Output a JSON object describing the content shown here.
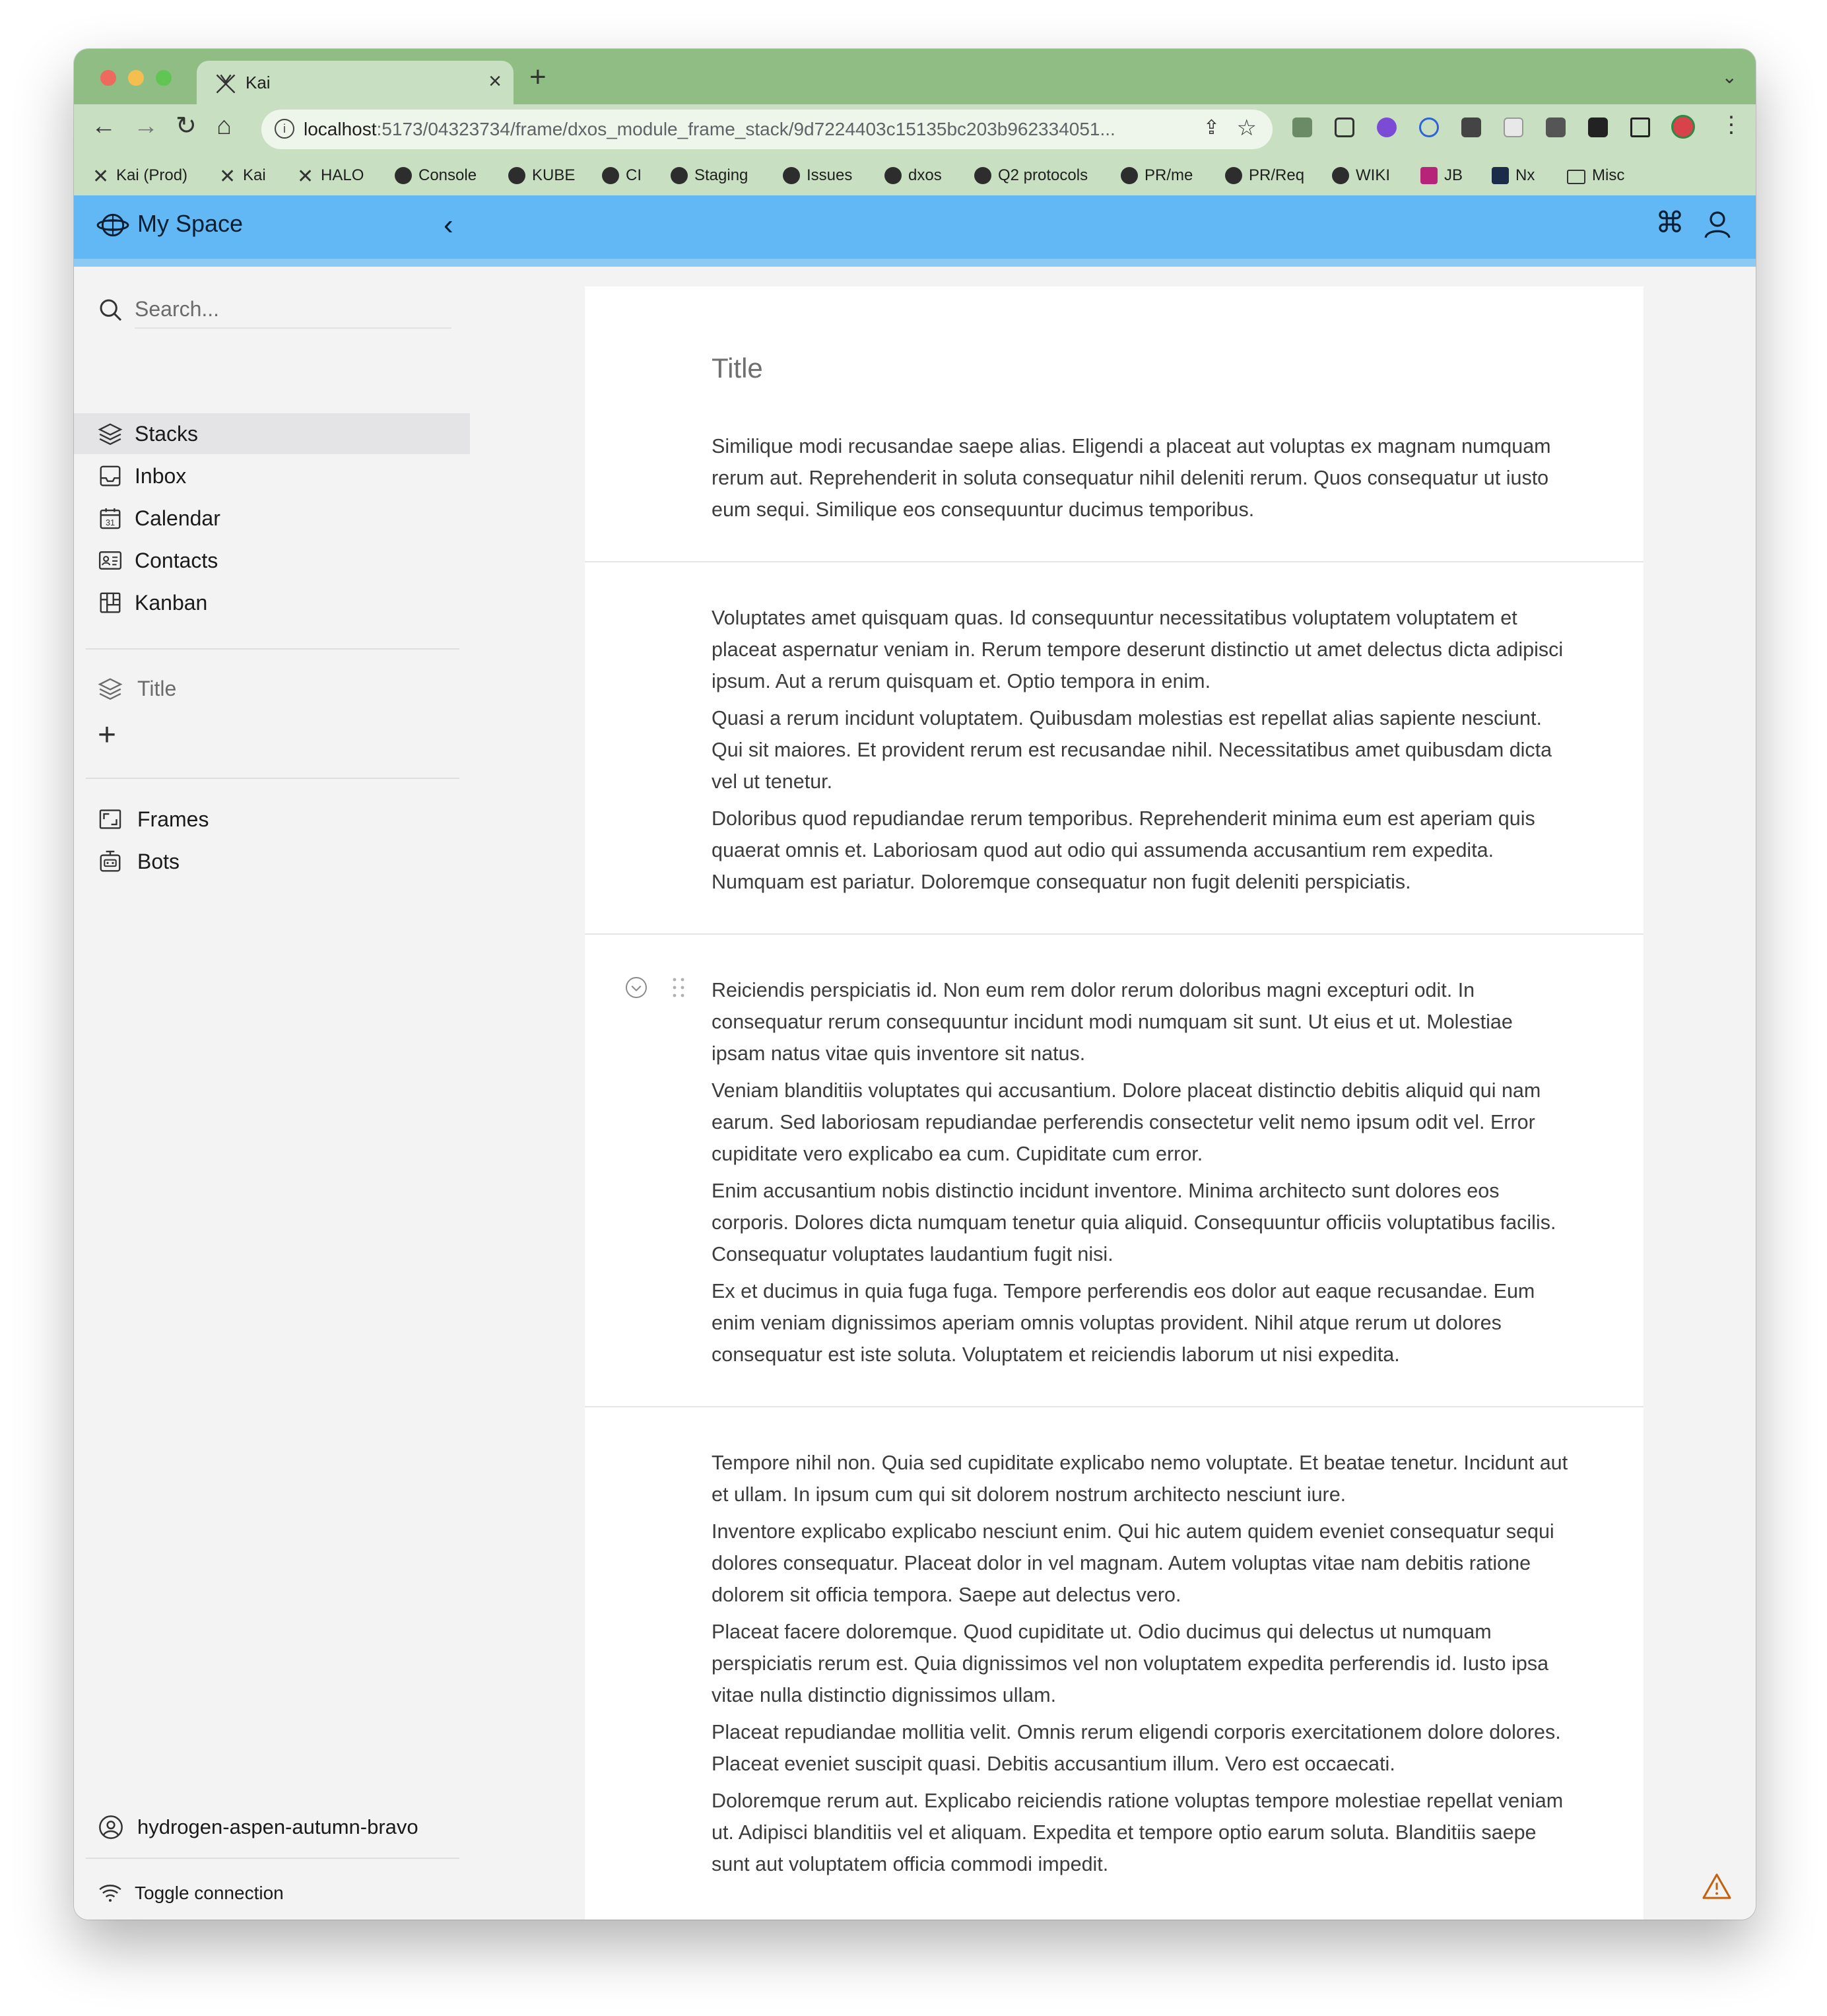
{
  "browser": {
    "tab_title": "Kai",
    "url_host": "localhost",
    "url_rest": ":5173/04323734/frame/dxos_module_frame_stack/9d7224403c15135bc203b962334051...",
    "bookmarks": [
      "Kai (Prod)",
      "Kai",
      "HALO",
      "Console",
      "KUBE",
      "CI",
      "Staging",
      "Issues",
      "dxos",
      "Q2 protocols",
      "PR/me",
      "PR/Req",
      "WIKI",
      "JB",
      "Nx",
      "Misc"
    ]
  },
  "header": {
    "space_name": "My Space"
  },
  "sidebar": {
    "search_placeholder": "Search...",
    "nav": [
      "Stacks",
      "Inbox",
      "Calendar",
      "Contacts",
      "Kanban"
    ],
    "stack_item": "Title",
    "frames": [
      "Frames",
      "Bots"
    ],
    "identity": "hydrogen-aspen-autumn-bravo",
    "toggle": "Toggle connection"
  },
  "stack": {
    "title": "Title",
    "sections": [
      [
        "Similique modi recusandae saepe alias. Eligendi a placeat aut voluptas ex magnam numquam rerum aut. Reprehenderit in soluta consequatur nihil deleniti rerum. Quos consequatur ut iusto eum sequi. Similique eos consequuntur ducimus temporibus."
      ],
      [
        "Voluptates amet quisquam quas. Id consequuntur necessitatibus voluptatem voluptatem et placeat aspernatur veniam in. Rerum tempore deserunt distinctio ut amet delectus dicta adipisci ipsum. Aut a rerum quisquam et. Optio tempora in enim.",
        "Quasi a rerum incidunt voluptatem. Quibusdam molestias est repellat alias sapiente nesciunt. Qui sit maiores. Et provident rerum est recusandae nihil. Necessitatibus amet quibusdam dicta vel ut tenetur.",
        "Doloribus quod repudiandae rerum temporibus. Reprehenderit minima eum est aperiam quis quaerat omnis et. Laboriosam quod aut odio qui assumenda accusantium rem expedita. Numquam est pariatur. Doloremque consequatur non fugit deleniti perspiciatis."
      ],
      [
        "Reiciendis perspiciatis id. Non eum rem dolor rerum doloribus magni excepturi odit. In consequatur rerum consequuntur incidunt modi numquam sit sunt. Ut eius et ut. Molestiae ipsam natus vitae quis inventore sit natus.",
        "Veniam blanditiis voluptates qui accusantium. Dolore placeat distinctio debitis aliquid qui nam earum. Sed laboriosam repudiandae perferendis consectetur velit nemo ipsum odit vel. Error cupiditate vero explicabo ea cum. Cupiditate cum error.",
        "Enim accusantium nobis distinctio incidunt inventore. Minima architecto sunt dolores eos corporis. Dolores dicta numquam tenetur quia aliquid. Consequuntur officiis voluptatibus facilis. Consequatur voluptates laudantium fugit nisi.",
        "Ex et ducimus in quia fuga fuga. Tempore perferendis eos dolor aut eaque recusandae. Eum enim veniam dignissimos aperiam omnis voluptas provident. Nihil atque rerum ut dolores consequatur est iste soluta. Voluptatem et reiciendis laborum ut nisi expedita."
      ],
      [
        "Tempore nihil non. Quia sed cupiditate explicabo nemo voluptate. Et beatae tenetur. Incidunt aut et ullam. In ipsum cum qui sit dolorem nostrum architecto nesciunt iure.",
        "Inventore explicabo explicabo nesciunt enim. Qui hic autem quidem eveniet consequatur sequi dolores consequatur. Placeat dolor in vel magnam. Autem voluptas vitae nam debitis ratione dolorem sit officia tempora. Saepe aut delectus vero.",
        "Placeat facere doloremque. Quod cupiditate ut. Odio ducimus qui delectus ut numquam perspiciatis rerum est. Quia dignissimos vel non voluptatem expedita perferendis id. Iusto ipsa vitae nulla distinctio dignissimos ullam.",
        "Placeat repudiandae mollitia velit. Omnis rerum eligendi corporis exercitationem dolore dolores. Placeat eveniet suscipit quasi. Debitis accusantium illum. Vero est occaecati.",
        "Doloremque rerum aut. Explicabo reiciendis ratione voluptas tempore molestiae repellat veniam ut. Adipisci blanditiis vel et aliquam. Expedita et tempore optio earum soluta. Blanditiis saepe sunt aut voluptatem officia commodi impedit."
      ]
    ]
  }
}
